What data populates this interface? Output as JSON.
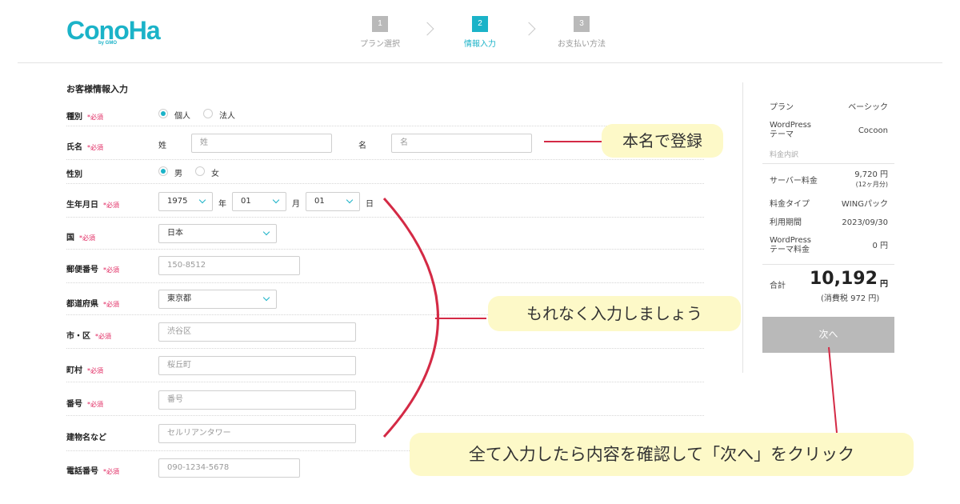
{
  "header": {
    "logo_text": "ConoHa",
    "logo_sub": "by GMO",
    "steps": [
      {
        "num": "1",
        "label": "プラン選択"
      },
      {
        "num": "2",
        "label": "情報入力"
      },
      {
        "num": "3",
        "label": "お支払い方法"
      }
    ]
  },
  "form": {
    "title": "お客様情報入力",
    "required_mark": "*必須",
    "type": {
      "label": "種別",
      "options": [
        "個人",
        "法人"
      ],
      "selected": "個人"
    },
    "name": {
      "label": "氏名",
      "last_label": "姓",
      "last_placeholder": "姓",
      "first_label": "名",
      "first_placeholder": "名"
    },
    "gender": {
      "label": "性別",
      "options": [
        "男",
        "女"
      ],
      "selected": "男"
    },
    "birth": {
      "label": "生年月日",
      "year": "1975",
      "year_unit": "年",
      "month": "01",
      "month_unit": "月",
      "day": "01",
      "day_unit": "日"
    },
    "country": {
      "label": "国",
      "value": "日本"
    },
    "postal": {
      "label": "郵便番号",
      "placeholder": "150-8512"
    },
    "prefecture": {
      "label": "都道府県",
      "value": "東京都"
    },
    "city": {
      "label": "市・区",
      "placeholder": "渋谷区"
    },
    "town": {
      "label": "町村",
      "placeholder": "桜丘町"
    },
    "number": {
      "label": "番号",
      "placeholder": "番号"
    },
    "building": {
      "label": "建物名など",
      "placeholder": "セルリアンタワー"
    },
    "phone": {
      "label": "電話番号",
      "placeholder": "090-1234-5678"
    }
  },
  "summary": {
    "plan_label": "プラン",
    "plan_value": "ベーシック",
    "theme_label_1": "WordPress",
    "theme_label_2": "テーマ",
    "theme_value": "Cocoon",
    "breakdown_label": "料金内訳",
    "server_label": "サーバー料金",
    "server_value": "9,720 円",
    "server_note": "(12ヶ月分)",
    "fee_type_label": "料金タイプ",
    "fee_type_value": "WINGパック",
    "period_label": "利用期間",
    "period_value": "2023/09/30",
    "theme_fee_label_1": "WordPress",
    "theme_fee_label_2": "テーマ料金",
    "theme_fee_value": "0 円",
    "total_label": "合計",
    "total_value": "10,192",
    "total_unit": "円",
    "tax_note": "(消費税 972 円)",
    "next_button": "次へ"
  },
  "annotations": {
    "name_note": "本名で登録",
    "fill_note": "もれなく入力しましょう",
    "next_note": "全て入力したら内容を確認して「次へ」をクリック"
  },
  "colors": {
    "accent": "#1bb3c8",
    "required": "#e0245e",
    "annotation": "#d42a45",
    "callout_bg": "#fdf9c8"
  }
}
